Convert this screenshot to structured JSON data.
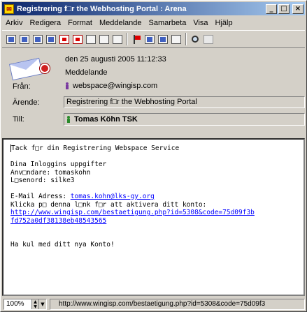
{
  "window": {
    "title": "Registrering f□r the Webhosting Portal : Arena"
  },
  "titlebar_buttons": {
    "minimize": "_",
    "maximize": "□",
    "close": "×"
  },
  "menu": [
    "Arkiv",
    "Redigera",
    "Format",
    "Meddelande",
    "Samarbeta",
    "Visa",
    "Hjälp"
  ],
  "toolbar": {
    "icons": [
      "reply-icon",
      "reply-all-icon",
      "forward-icon",
      "forward-attach-icon",
      "delete-red-icon",
      "copy-red-icon",
      "print-icon",
      "save-icon",
      "trash-icon",
      "flag-icon",
      "move-icon",
      "move-folder-icon",
      "folder-icon",
      "search-icon",
      "tools-icon"
    ]
  },
  "header": {
    "date": "den 25 augusti 2005 11:12:33",
    "type": "Meddelande",
    "from_label": "Från:",
    "from_value": "webspace@wingisp.com",
    "subject_label": "Ärende:",
    "subject_value": "Registrering f□r the Webhosting Portal",
    "to_label": "Till:",
    "to_value": "Tomas Köhn TSK"
  },
  "body": {
    "line1": "Tack f□r din Registrering Webspace Service",
    "line2": "Dina Inloggins uppgifter",
    "line3": "Anv□ndare: tomaskohn",
    "line4": "L□senord: silke3",
    "email_label": "E-Mail Adress: ",
    "email_link": "tomas.kohn@lks-gy.org",
    "line6": "Klicka p□ denna l□nk f□r att aktivera ditt konto:",
    "link_part1": "http://www.wingisp.com/bestaetigung.php?id=5308&code=75d09f3b",
    "link_part2": "fd752a0df38138eb48543565",
    "closing": "Ha kul med ditt nya Konto!"
  },
  "statusbar": {
    "zoom": "100%",
    "text": "http://www.wingisp.com/bestaetigung.php?id=5308&code=75d09f3"
  }
}
